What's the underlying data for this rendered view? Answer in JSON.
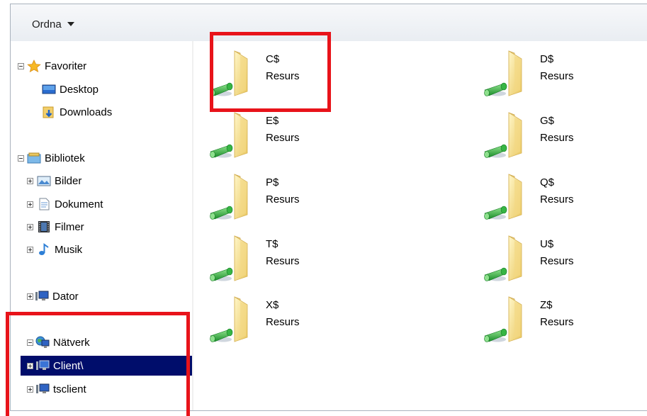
{
  "toolbar": {
    "organize_label": "Ordna"
  },
  "nav": {
    "favorites": {
      "label": "Favoriter",
      "items": [
        {
          "label": "Desktop"
        },
        {
          "label": "Downloads"
        }
      ]
    },
    "libraries": {
      "label": "Bibliotek",
      "items": [
        {
          "label": "Bilder"
        },
        {
          "label": "Dokument"
        },
        {
          "label": "Filmer"
        },
        {
          "label": "Musik"
        }
      ]
    },
    "computer": {
      "label": "Dator"
    },
    "network": {
      "label": "Nätverk",
      "items": [
        {
          "label": "Client\\",
          "selected": true
        },
        {
          "label": "tsclient"
        }
      ]
    }
  },
  "shares": [
    {
      "name": "C$",
      "type": "Resurs"
    },
    {
      "name": "D$",
      "type": "Resurs"
    },
    {
      "name": "E$",
      "type": "Resurs"
    },
    {
      "name": "G$",
      "type": "Resurs"
    },
    {
      "name": "P$",
      "type": "Resurs"
    },
    {
      "name": "Q$",
      "type": "Resurs"
    },
    {
      "name": "T$",
      "type": "Resurs"
    },
    {
      "name": "U$",
      "type": "Resurs"
    },
    {
      "name": "X$",
      "type": "Resurs"
    },
    {
      "name": "Z$",
      "type": "Resurs"
    }
  ],
  "colors": {
    "highlight": "#e8131a",
    "selection": "#000d6b"
  }
}
